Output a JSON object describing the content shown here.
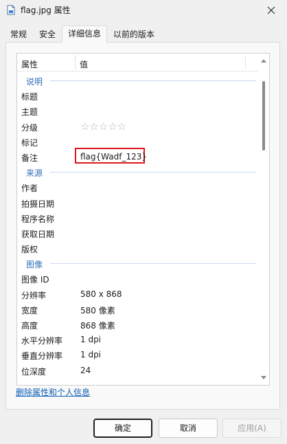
{
  "window": {
    "title": "flag.jpg 属性",
    "close_icon": "close-icon",
    "file_icon": "document-icon"
  },
  "tabs": [
    {
      "label": "常规",
      "active": false
    },
    {
      "label": "安全",
      "active": false
    },
    {
      "label": "详细信息",
      "active": true
    },
    {
      "label": "以前的版本",
      "active": false
    }
  ],
  "columns": {
    "property": "属性",
    "value": "值"
  },
  "rows": [
    {
      "type": "section",
      "label": "说明"
    },
    {
      "type": "item",
      "label": "标题",
      "value": ""
    },
    {
      "type": "item",
      "label": "主题",
      "value": ""
    },
    {
      "type": "rating",
      "label": "分级",
      "stars": 0,
      "max_stars": 5,
      "star_glyphs": "☆☆☆☆☆"
    },
    {
      "type": "item",
      "label": "标记",
      "value": ""
    },
    {
      "type": "item",
      "label": "备注",
      "value": "flag{Wadf_123}",
      "highlighted": true
    },
    {
      "type": "section",
      "label": "来源"
    },
    {
      "type": "item",
      "label": "作者",
      "value": ""
    },
    {
      "type": "item",
      "label": "拍摄日期",
      "value": ""
    },
    {
      "type": "item",
      "label": "程序名称",
      "value": ""
    },
    {
      "type": "item",
      "label": "获取日期",
      "value": ""
    },
    {
      "type": "item",
      "label": "版权",
      "value": ""
    },
    {
      "type": "section",
      "label": "图像"
    },
    {
      "type": "item",
      "label": "图像 ID",
      "value": ""
    },
    {
      "type": "item",
      "label": "分辨率",
      "value": "580 x 868"
    },
    {
      "type": "item",
      "label": "宽度",
      "value": "580 像素"
    },
    {
      "type": "item",
      "label": "高度",
      "value": "868 像素"
    },
    {
      "type": "item",
      "label": "水平分辨率",
      "value": "1 dpi"
    },
    {
      "type": "item",
      "label": "垂直分辨率",
      "value": "1 dpi"
    },
    {
      "type": "item",
      "label": "位深度",
      "value": "24"
    }
  ],
  "remove_link": "删除属性和个人信息",
  "buttons": {
    "ok": "确定",
    "cancel": "取消",
    "apply": "应用(A)"
  },
  "colors": {
    "section": "#2f6eb5",
    "link": "#0f5fb6",
    "highlight_border": "#e0161c"
  }
}
